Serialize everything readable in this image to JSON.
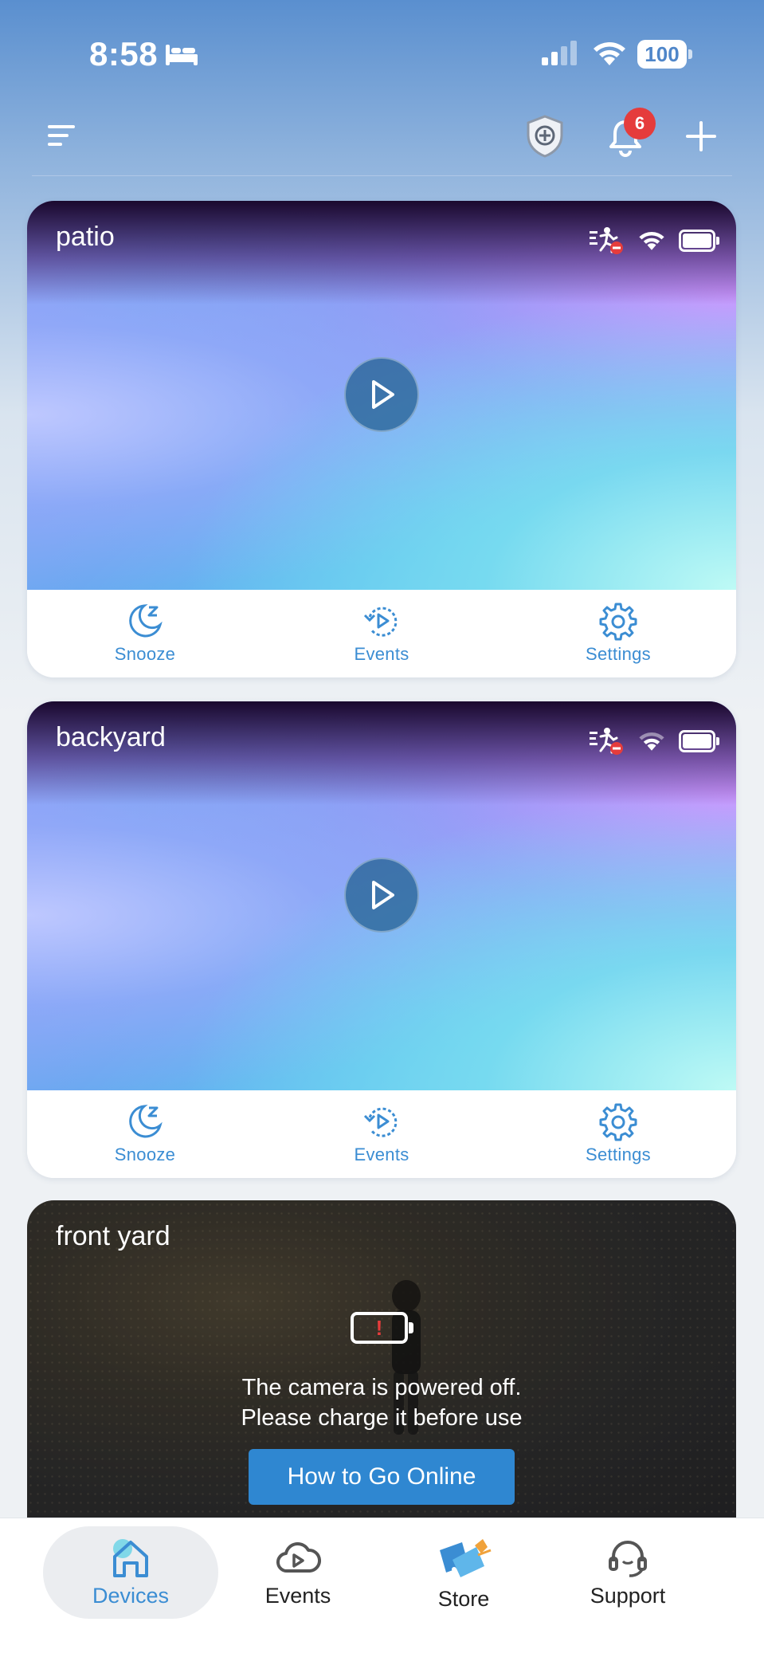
{
  "status_bar": {
    "time": "8:58",
    "battery": "100"
  },
  "toolbar": {
    "notification_count": "6"
  },
  "cards": [
    {
      "name": "patio",
      "actions": {
        "snooze": "Snooze",
        "events": "Events",
        "settings": "Settings"
      }
    },
    {
      "name": "backyard",
      "actions": {
        "snooze": "Snooze",
        "events": "Events",
        "settings": "Settings"
      }
    },
    {
      "name": "front yard",
      "message_line1": "The camera is powered off.",
      "message_line2": "Please charge it before use",
      "button": "How to Go Online",
      "battery_alert": "!"
    }
  ],
  "bottom_nav": [
    {
      "label": "Devices",
      "active": true
    },
    {
      "label": "Events",
      "active": false
    },
    {
      "label": "Store",
      "active": false
    },
    {
      "label": "Support",
      "active": false
    }
  ],
  "colors": {
    "accent": "#3b8dd3",
    "badge": "#e53c3c",
    "button": "#2f87d1"
  }
}
